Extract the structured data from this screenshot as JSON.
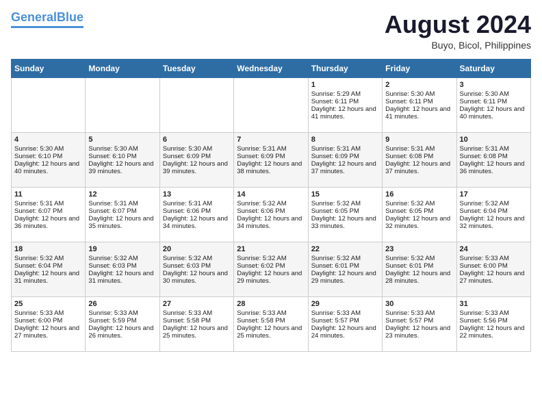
{
  "header": {
    "logo_line1": "General",
    "logo_line2": "Blue",
    "month_year": "August 2024",
    "location": "Buyo, Bicol, Philippines"
  },
  "days_of_week": [
    "Sunday",
    "Monday",
    "Tuesday",
    "Wednesday",
    "Thursday",
    "Friday",
    "Saturday"
  ],
  "weeks": [
    [
      {
        "day": "",
        "sunrise": "",
        "sunset": "",
        "daylight": ""
      },
      {
        "day": "",
        "sunrise": "",
        "sunset": "",
        "daylight": ""
      },
      {
        "day": "",
        "sunrise": "",
        "sunset": "",
        "daylight": ""
      },
      {
        "day": "",
        "sunrise": "",
        "sunset": "",
        "daylight": ""
      },
      {
        "day": "1",
        "sunrise": "Sunrise: 5:29 AM",
        "sunset": "Sunset: 6:11 PM",
        "daylight": "Daylight: 12 hours and 41 minutes."
      },
      {
        "day": "2",
        "sunrise": "Sunrise: 5:30 AM",
        "sunset": "Sunset: 6:11 PM",
        "daylight": "Daylight: 12 hours and 41 minutes."
      },
      {
        "day": "3",
        "sunrise": "Sunrise: 5:30 AM",
        "sunset": "Sunset: 6:11 PM",
        "daylight": "Daylight: 12 hours and 40 minutes."
      }
    ],
    [
      {
        "day": "4",
        "sunrise": "Sunrise: 5:30 AM",
        "sunset": "Sunset: 6:10 PM",
        "daylight": "Daylight: 12 hours and 40 minutes."
      },
      {
        "day": "5",
        "sunrise": "Sunrise: 5:30 AM",
        "sunset": "Sunset: 6:10 PM",
        "daylight": "Daylight: 12 hours and 39 minutes."
      },
      {
        "day": "6",
        "sunrise": "Sunrise: 5:30 AM",
        "sunset": "Sunset: 6:09 PM",
        "daylight": "Daylight: 12 hours and 39 minutes."
      },
      {
        "day": "7",
        "sunrise": "Sunrise: 5:31 AM",
        "sunset": "Sunset: 6:09 PM",
        "daylight": "Daylight: 12 hours and 38 minutes."
      },
      {
        "day": "8",
        "sunrise": "Sunrise: 5:31 AM",
        "sunset": "Sunset: 6:09 PM",
        "daylight": "Daylight: 12 hours and 37 minutes."
      },
      {
        "day": "9",
        "sunrise": "Sunrise: 5:31 AM",
        "sunset": "Sunset: 6:08 PM",
        "daylight": "Daylight: 12 hours and 37 minutes."
      },
      {
        "day": "10",
        "sunrise": "Sunrise: 5:31 AM",
        "sunset": "Sunset: 6:08 PM",
        "daylight": "Daylight: 12 hours and 36 minutes."
      }
    ],
    [
      {
        "day": "11",
        "sunrise": "Sunrise: 5:31 AM",
        "sunset": "Sunset: 6:07 PM",
        "daylight": "Daylight: 12 hours and 36 minutes."
      },
      {
        "day": "12",
        "sunrise": "Sunrise: 5:31 AM",
        "sunset": "Sunset: 6:07 PM",
        "daylight": "Daylight: 12 hours and 35 minutes."
      },
      {
        "day": "13",
        "sunrise": "Sunrise: 5:31 AM",
        "sunset": "Sunset: 6:06 PM",
        "daylight": "Daylight: 12 hours and 34 minutes."
      },
      {
        "day": "14",
        "sunrise": "Sunrise: 5:32 AM",
        "sunset": "Sunset: 6:06 PM",
        "daylight": "Daylight: 12 hours and 34 minutes."
      },
      {
        "day": "15",
        "sunrise": "Sunrise: 5:32 AM",
        "sunset": "Sunset: 6:05 PM",
        "daylight": "Daylight: 12 hours and 33 minutes."
      },
      {
        "day": "16",
        "sunrise": "Sunrise: 5:32 AM",
        "sunset": "Sunset: 6:05 PM",
        "daylight": "Daylight: 12 hours and 32 minutes."
      },
      {
        "day": "17",
        "sunrise": "Sunrise: 5:32 AM",
        "sunset": "Sunset: 6:04 PM",
        "daylight": "Daylight: 12 hours and 32 minutes."
      }
    ],
    [
      {
        "day": "18",
        "sunrise": "Sunrise: 5:32 AM",
        "sunset": "Sunset: 6:04 PM",
        "daylight": "Daylight: 12 hours and 31 minutes."
      },
      {
        "day": "19",
        "sunrise": "Sunrise: 5:32 AM",
        "sunset": "Sunset: 6:03 PM",
        "daylight": "Daylight: 12 hours and 31 minutes."
      },
      {
        "day": "20",
        "sunrise": "Sunrise: 5:32 AM",
        "sunset": "Sunset: 6:03 PM",
        "daylight": "Daylight: 12 hours and 30 minutes."
      },
      {
        "day": "21",
        "sunrise": "Sunrise: 5:32 AM",
        "sunset": "Sunset: 6:02 PM",
        "daylight": "Daylight: 12 hours and 29 minutes."
      },
      {
        "day": "22",
        "sunrise": "Sunrise: 5:32 AM",
        "sunset": "Sunset: 6:01 PM",
        "daylight": "Daylight: 12 hours and 29 minutes."
      },
      {
        "day": "23",
        "sunrise": "Sunrise: 5:32 AM",
        "sunset": "Sunset: 6:01 PM",
        "daylight": "Daylight: 12 hours and 28 minutes."
      },
      {
        "day": "24",
        "sunrise": "Sunrise: 5:33 AM",
        "sunset": "Sunset: 6:00 PM",
        "daylight": "Daylight: 12 hours and 27 minutes."
      }
    ],
    [
      {
        "day": "25",
        "sunrise": "Sunrise: 5:33 AM",
        "sunset": "Sunset: 6:00 PM",
        "daylight": "Daylight: 12 hours and 27 minutes."
      },
      {
        "day": "26",
        "sunrise": "Sunrise: 5:33 AM",
        "sunset": "Sunset: 5:59 PM",
        "daylight": "Daylight: 12 hours and 26 minutes."
      },
      {
        "day": "27",
        "sunrise": "Sunrise: 5:33 AM",
        "sunset": "Sunset: 5:58 PM",
        "daylight": "Daylight: 12 hours and 25 minutes."
      },
      {
        "day": "28",
        "sunrise": "Sunrise: 5:33 AM",
        "sunset": "Sunset: 5:58 PM",
        "daylight": "Daylight: 12 hours and 25 minutes."
      },
      {
        "day": "29",
        "sunrise": "Sunrise: 5:33 AM",
        "sunset": "Sunset: 5:57 PM",
        "daylight": "Daylight: 12 hours and 24 minutes."
      },
      {
        "day": "30",
        "sunrise": "Sunrise: 5:33 AM",
        "sunset": "Sunset: 5:57 PM",
        "daylight": "Daylight: 12 hours and 23 minutes."
      },
      {
        "day": "31",
        "sunrise": "Sunrise: 5:33 AM",
        "sunset": "Sunset: 5:56 PM",
        "daylight": "Daylight: 12 hours and 22 minutes."
      }
    ]
  ]
}
